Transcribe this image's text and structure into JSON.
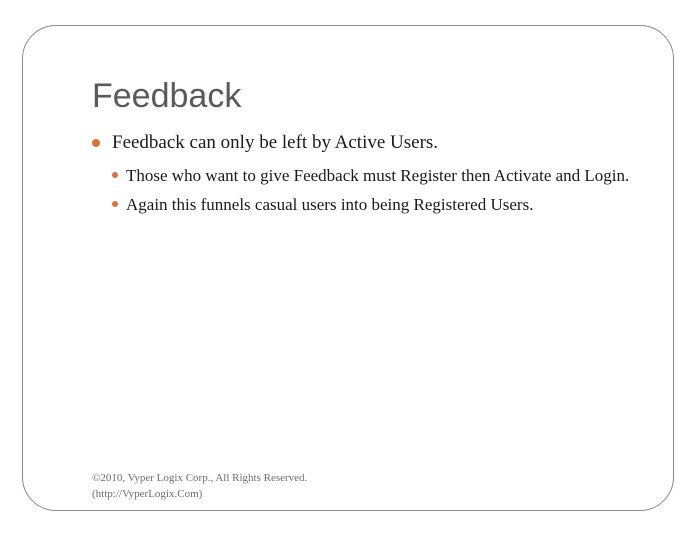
{
  "slide": {
    "title": "Feedback",
    "bullets": [
      {
        "text": "Feedback can only be left by Active Users.",
        "children": [
          {
            "text": "Those who want to give Feedback must Register then Activate and Login."
          },
          {
            "text": "Again this funnels casual users into being Registered Users."
          }
        ]
      }
    ],
    "footer": {
      "line1": "©2010, Vyper Logix Corp., All Rights Reserved.",
      "line2": "(http://VyperLogix.Com)"
    }
  },
  "colors": {
    "bullet": "#d9733a",
    "title": "#5a5a5a",
    "frame": "#8c8c8c"
  }
}
